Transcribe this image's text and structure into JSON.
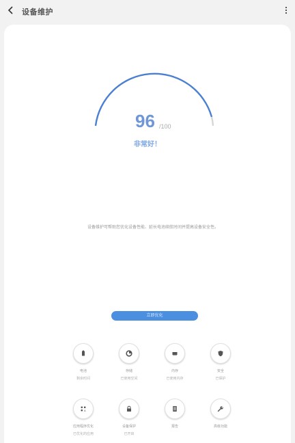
{
  "header": {
    "title": "设备维护",
    "more_icon": "more-vert-icon",
    "back_icon": "chevron-left-icon"
  },
  "score": {
    "value": "96",
    "max": "/100",
    "status": "非常好！"
  },
  "description": "设备维护可帮助您优化设备性能、延长电池续航时间并提高设备安全性。",
  "optimize_button": "立即优化",
  "colors": {
    "accent": "#4a8fe0",
    "gauge": "#4a7fd1",
    "score": "#6f96d6"
  },
  "tiles": [
    {
      "label": "电池",
      "sub": "剩余时间",
      "icon": "battery-icon"
    },
    {
      "label": "存储",
      "sub": "已使用空间",
      "icon": "pie-chart-icon"
    },
    {
      "label": "内存",
      "sub": "已使用内存",
      "icon": "memory-icon"
    },
    {
      "label": "安全",
      "sub": "已保护",
      "icon": "shield-icon"
    },
    {
      "label": "应用程序优化",
      "sub": "已优化的应用",
      "icon": "apps-icon"
    },
    {
      "label": "设备保护",
      "sub": "已开启",
      "icon": "lock-icon"
    },
    {
      "label": "报告",
      "sub": "",
      "icon": "report-icon"
    },
    {
      "label": "高级功能",
      "sub": "",
      "icon": "wrench-icon"
    }
  ]
}
